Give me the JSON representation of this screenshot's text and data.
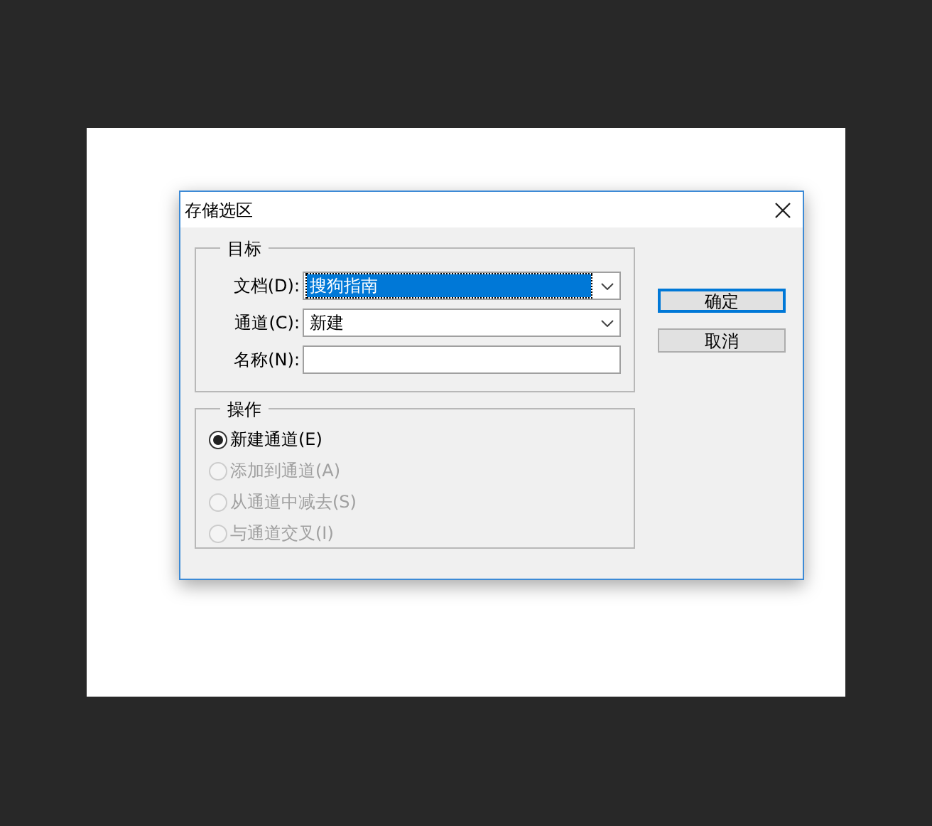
{
  "window": {
    "title": "存储选区"
  },
  "target_group": {
    "title": "目标",
    "fields": [
      {
        "kind": "dropdown",
        "label": "文档(D):",
        "value": "搜狗指南",
        "focused": true
      },
      {
        "kind": "dropdown",
        "label": "通道(C):",
        "value": "新建",
        "focused": false
      },
      {
        "kind": "text",
        "label": "名称(N):"
      }
    ]
  },
  "operation_group": {
    "title": "操作",
    "options": [
      {
        "label": "新建通道(E)",
        "selected": true,
        "disabled": false
      },
      {
        "label": "添加到通道(A)",
        "selected": false,
        "disabled": true
      },
      {
        "label": "从通道中减去(S)",
        "selected": false,
        "disabled": true
      },
      {
        "label": "与通道交叉(I)",
        "selected": false,
        "disabled": true
      }
    ]
  },
  "buttons": [
    {
      "label": "确定",
      "default": true
    },
    {
      "label": "取消",
      "default": false
    }
  ]
}
